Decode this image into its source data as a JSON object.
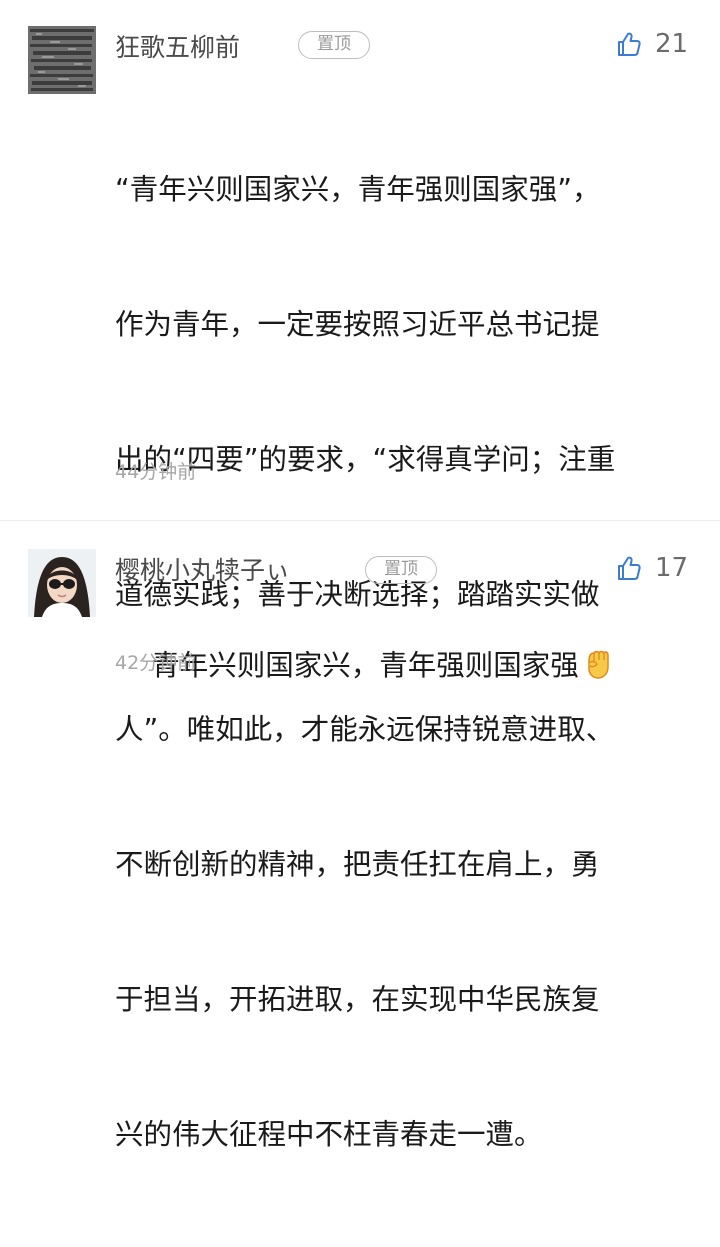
{
  "comments": [
    {
      "username": "狂歌五柳前",
      "pin_label": "置顶",
      "like_count": "21",
      "text_lines": [
        "“青年兴则国家兴，青年强则国家强”，",
        "作为青年，一定要按照习近平总书记提",
        "出的“四要”的要求，“求得真学问；注重",
        "道德实践；善于决断选择；踏踏实实做",
        "人”。唯如此，才能永远保持锐意进取、",
        "不断创新的精神，把责任扛在肩上，勇",
        "于担当，开拓进取，在实现中华民族复",
        "兴的伟大征程中不枉青春走一遭。"
      ],
      "time": "44分钟前"
    },
    {
      "username": "樱桃小丸犊子ぃ",
      "pin_label": "置顶",
      "like_count": "17",
      "text": "青年兴则国家兴，青年强则国家强",
      "emoji_icon": "raised-fist-emoji",
      "time": "42分钟前"
    }
  ],
  "colors": {
    "background": "#ffffff",
    "username": "#4a4a4a",
    "body_text": "#1a1a1a",
    "meta_text": "#a6a6a6",
    "pin_border": "#bdbdbd"
  },
  "icons": {
    "like": "thumbs-up-icon"
  }
}
